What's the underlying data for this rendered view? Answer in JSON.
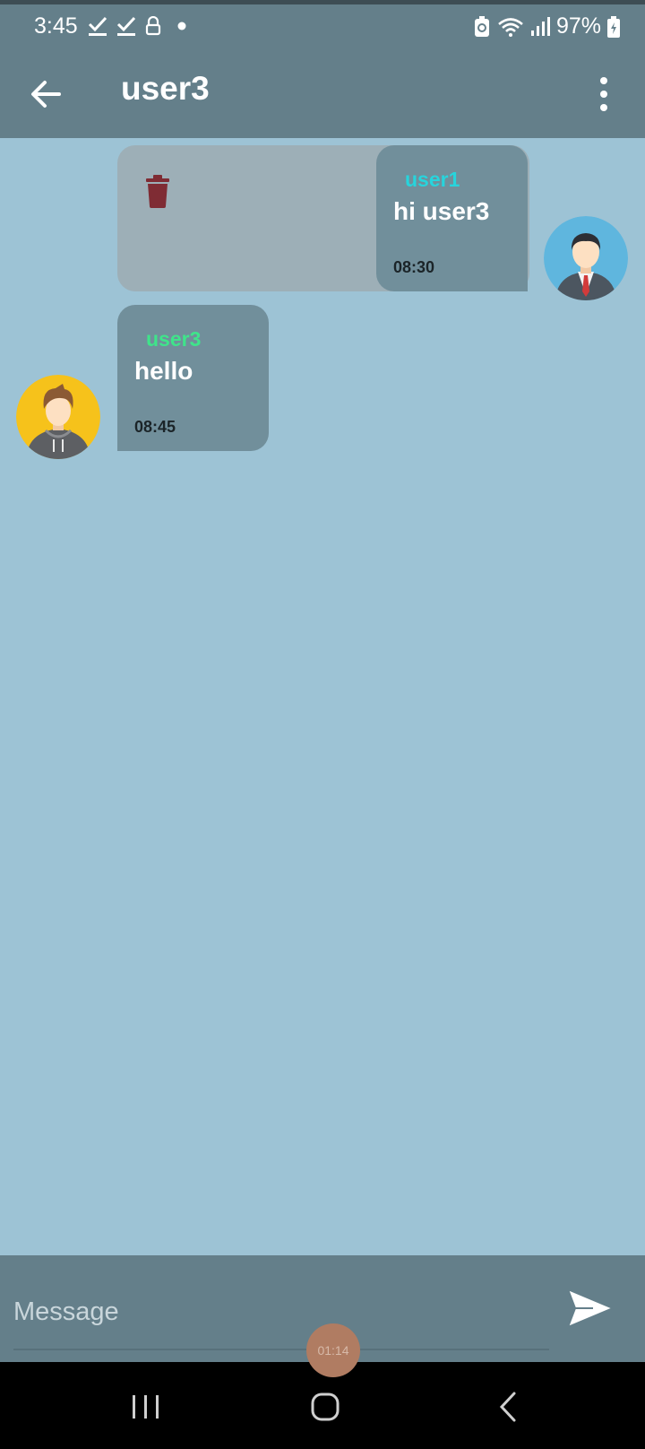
{
  "status_bar": {
    "time": "3:45",
    "battery": "97%",
    "left_icons": [
      "check-icon",
      "check-icon",
      "lock-icon",
      "dot-icon"
    ],
    "right_icons": [
      "battery-saver-icon",
      "wifi-icon",
      "signal-icon",
      "battery-charging-icon"
    ]
  },
  "header": {
    "title": "user3",
    "back_icon": "arrow-left-icon",
    "menu_icon": "more-vertical-icon"
  },
  "messages": [
    {
      "sender": "user1",
      "text": "hi user3",
      "time": "08:30",
      "direction": "outgoing",
      "sender_color": "#27d4dc",
      "swiped": true,
      "swipe_action_icon": "trash-icon"
    },
    {
      "sender": "user3",
      "text": "hello",
      "time": "08:45",
      "direction": "incoming",
      "sender_color": "#3fe48a"
    }
  ],
  "composer": {
    "placeholder": "Message",
    "send_icon": "send-icon"
  },
  "timer_badge": "01:14",
  "colors": {
    "app_bar": "#647f8a",
    "background": "#9dc3d5",
    "bubble": "#718f9b",
    "delete_red": "#7f2c34"
  },
  "nav": [
    "recent-apps-icon",
    "home-icon",
    "back-icon"
  ]
}
